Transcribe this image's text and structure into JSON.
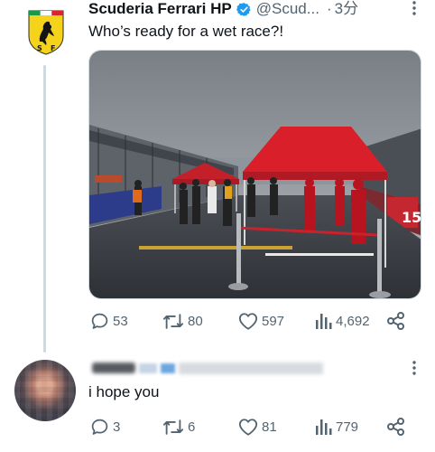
{
  "tweet": {
    "author": {
      "display_name": "Scuderia Ferrari HP",
      "handle": "@Scud...",
      "verified": true,
      "avatar_icon": "ferrari-shield-logo",
      "avatar_lettering": "SF"
    },
    "time_separator": "·",
    "time": "3分",
    "text": "Who’s ready for a wet race?!",
    "media": {
      "type": "photo"
    },
    "stats": {
      "replies": "53",
      "retweets": "80",
      "likes": "597",
      "views": "4,692"
    }
  },
  "reply": {
    "text": "i hope you",
    "stats": {
      "replies": "3",
      "retweets": "6",
      "likes": "81",
      "views": "779"
    }
  },
  "colors": {
    "text_primary": "#0f1419",
    "text_secondary": "#536471",
    "verified_blue": "#1d9bf0",
    "ferrari_yellow": "#f6d31b",
    "tent_red": "#d81f2a",
    "thread_line": "#cfd9de"
  },
  "icons": [
    "more-icon",
    "verified-badge-icon",
    "reply-icon",
    "retweet-icon",
    "like-icon",
    "views-icon",
    "share-icon"
  ]
}
